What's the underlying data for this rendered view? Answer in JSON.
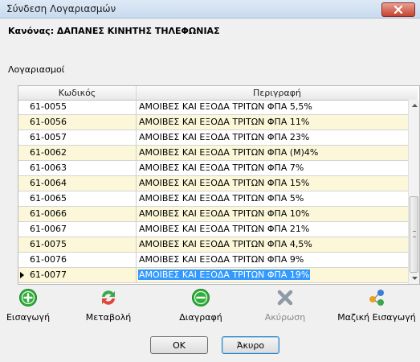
{
  "window": {
    "title": "Σύνδεση Λογαριασμών"
  },
  "rule": {
    "text": "Κανόνας: ΔΑΠΑΝΕΣ ΚΙΝΗΤΗΣ ΤΗΛΕΦΩΝΙΑΣ"
  },
  "accounts": {
    "label": "Λογαριασμοί",
    "columns": {
      "code": "Κωδικός",
      "description": "Περιγραφή"
    },
    "rows": [
      {
        "code": "61-0055",
        "description": "ΑΜΟΙΒΕΣ ΚΑΙ ΕΞΟΔΑ ΤΡΙΤΩΝ ΦΠΑ 5,5%"
      },
      {
        "code": "61-0056",
        "description": "ΑΜΟΙΒΕΣ ΚΑΙ ΕΞΟΔΑ ΤΡΙΤΩΝ ΦΠΑ 11%"
      },
      {
        "code": "61-0057",
        "description": "ΑΜΟΙΒΕΣ ΚΑΙ ΕΞΟΔΑ ΤΡΙΤΩΝ ΦΠΑ 23%"
      },
      {
        "code": "61-0062",
        "description": "ΑΜΟΙΒΕΣ ΚΑΙ ΕΞΟΔΑ ΤΡΙΤΩΝ ΦΠΑ (Μ)4%"
      },
      {
        "code": "61-0063",
        "description": "ΑΜΟΙΒΕΣ ΚΑΙ ΕΞΟΔΑ ΤΡΙΤΩΝ ΦΠΑ 7%"
      },
      {
        "code": "61-0064",
        "description": "ΑΜΟΙΒΕΣ ΚΑΙ ΕΞΟΔΑ ΤΡΙΤΩΝ ΦΠΑ 15%"
      },
      {
        "code": "61-0065",
        "description": "ΑΜΟΙΒΕΣ ΚΑΙ ΕΞΟΔΑ ΤΡΙΤΩΝ ΦΠΑ 5%"
      },
      {
        "code": "61-0066",
        "description": "ΑΜΟΙΒΕΣ ΚΑΙ ΕΞΟΔΑ ΤΡΙΤΩΝ ΦΠΑ 10%"
      },
      {
        "code": "61-0067",
        "description": "ΑΜΟΙΒΕΣ ΚΑΙ ΕΞΟΔΑ ΤΡΙΤΩΝ ΦΠΑ 21%"
      },
      {
        "code": "61-0075",
        "description": "ΑΜΟΙΒΕΣ ΚΑΙ ΕΞΟΔΑ ΤΡΙΤΩΝ ΦΠΑ 4,5%"
      },
      {
        "code": "61-0076",
        "description": "ΑΜΟΙΒΕΣ ΚΑΙ ΕΞΟΔΑ ΤΡΙΤΩΝ ΦΠΑ 9%"
      },
      {
        "code": "61-0077",
        "description": "ΑΜΟΙΒΕΣ ΚΑΙ ΕΞΟΔΑ ΤΡΙΤΩΝ ΦΠΑ 19%"
      }
    ]
  },
  "toolbar": {
    "add": "Εισαγωγή",
    "change": "Μεταβολή",
    "delete": "Διαγραφή",
    "cancel_op": "Ακύρωση",
    "bulk_add": "Μαζική Εισαγωγή"
  },
  "buttons": {
    "ok": "OK",
    "cancel": "Άκυρο"
  },
  "colors": {
    "row_alt": "#fbf7d8",
    "selection": "#3399ff",
    "add_icon": "#2fae3a",
    "delete_icon": "#2fae3a",
    "close_button": "#c7432f"
  },
  "icons": {
    "close": "close-icon",
    "add": "plus-circle-icon",
    "change": "refresh-arrows-icon",
    "delete": "minus-circle-icon",
    "cancel_op": "x-cross-icon",
    "bulk_add": "multi-dots-icon"
  }
}
